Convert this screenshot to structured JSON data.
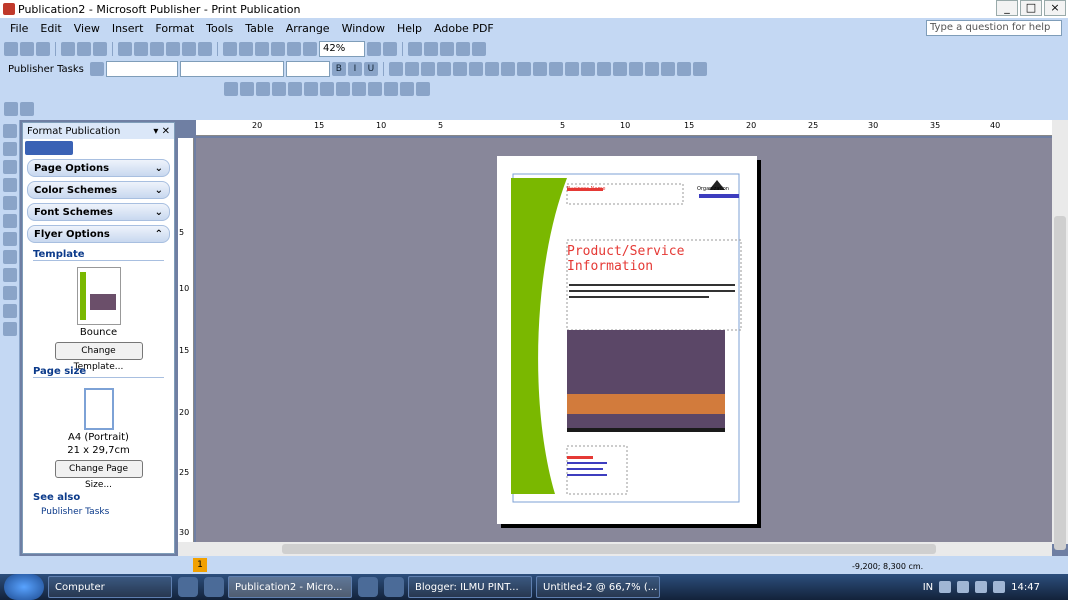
{
  "window": {
    "title": "Publication2 - Microsoft Publisher - Print Publication"
  },
  "menu": [
    "File",
    "Edit",
    "View",
    "Insert",
    "Format",
    "Tools",
    "Table",
    "Arrange",
    "Window",
    "Help",
    "Adobe PDF"
  ],
  "help_placeholder": "Type a question for help",
  "toolbar": {
    "zoom": "42%",
    "publisher_tasks": "Publisher Tasks"
  },
  "task_pane": {
    "title": "Format Publication",
    "sections": [
      "Page Options",
      "Color Schemes",
      "Font Schemes",
      "Flyer Options"
    ],
    "template_label": "Template",
    "template_name": "Bounce",
    "change_template": "Change Template...",
    "page_size_label": "Page size",
    "page_size_name": "A4 (Portrait)",
    "page_size_dims": "21 x 29,7cm",
    "change_page_size": "Change Page Size...",
    "see_also": "See also",
    "publisher_tasks": "Publisher Tasks"
  },
  "rulers": {
    "top": [
      "20",
      "15",
      "10",
      "5",
      "5",
      "10",
      "15",
      "20",
      "25",
      "30",
      "35",
      "40"
    ],
    "left": [
      "5",
      "10",
      "15",
      "20",
      "25",
      "30"
    ]
  },
  "flyer": {
    "business_name": "Business Name",
    "product_title": "Product/Service Information",
    "org_name": "Organization"
  },
  "status": {
    "coords": "-9,200; 8,300 cm.",
    "page_number": "1"
  },
  "taskbar": {
    "items": [
      "Computer",
      "Publication2 - Micro...",
      "Blogger: ILMU PINT...",
      "Untitled-2 @ 66,7% (..."
    ],
    "lang": "IN",
    "clock": "14:47"
  }
}
